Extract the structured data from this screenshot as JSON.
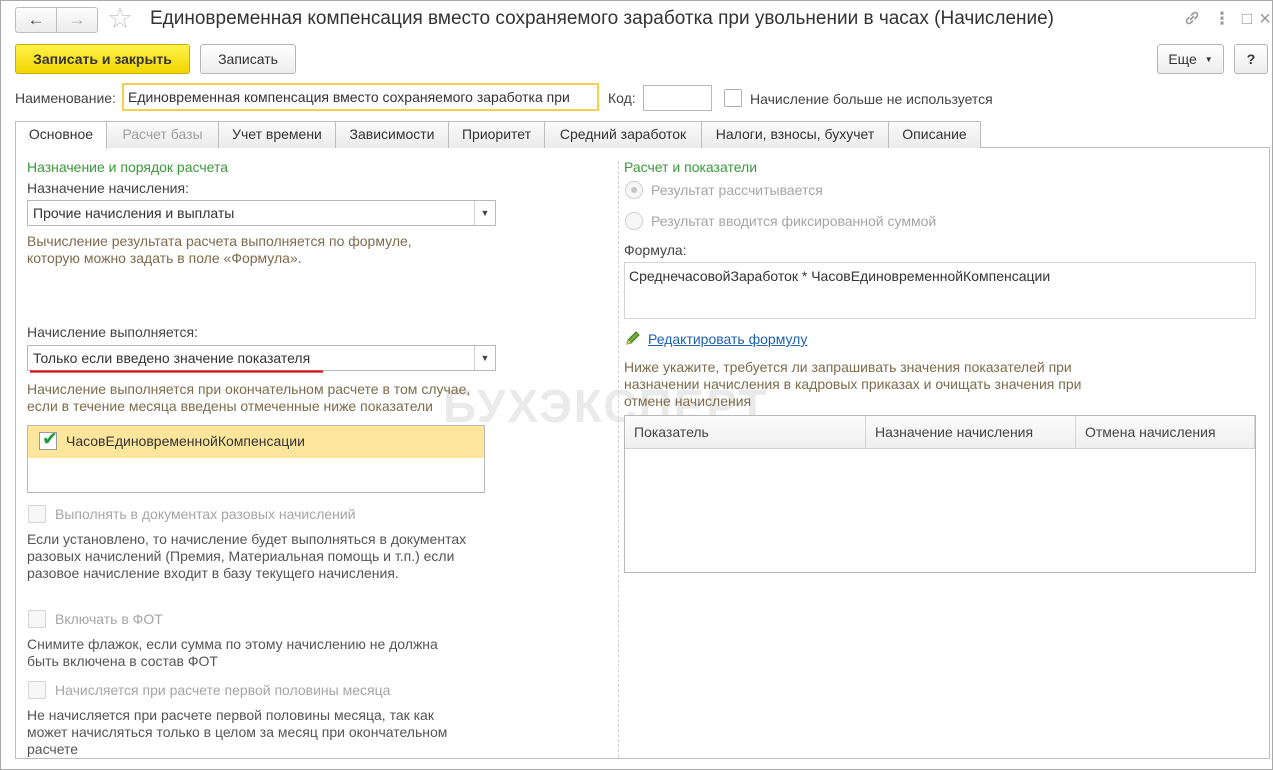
{
  "window": {
    "title": "Единовременная компенсация вместо сохраняемого заработка при увольнении в часах (Начисление)",
    "nav_back": "←",
    "nav_forward": "→",
    "favorite_icon": "☆",
    "link_icon": "🔗",
    "more_icon": "⋮",
    "maximize_icon": "□",
    "close_icon": "×"
  },
  "toolbar": {
    "save_close_label": "Записать и закрыть",
    "save_label": "Записать",
    "more_label": "Еще",
    "help_label": "?"
  },
  "header": {
    "name_label": "Наименование:",
    "name_value": "Единовременная компенсация вместо сохраняемого заработка при",
    "code_label": "Код:",
    "code_value": "",
    "not_used_label": "Начисление больше не используется"
  },
  "tabs": [
    {
      "label": "Основное"
    },
    {
      "label": "Расчет базы"
    },
    {
      "label": "Учет времени"
    },
    {
      "label": "Зависимости"
    },
    {
      "label": "Приоритет"
    },
    {
      "label": "Средний заработок"
    },
    {
      "label": "Налоги, взносы, бухучет"
    },
    {
      "label": "Описание"
    }
  ],
  "left": {
    "group_title": "Назначение и порядок расчета",
    "purpose_label": "Назначение начисления:",
    "purpose_value": "Прочие начисления и выплаты",
    "purpose_hint": "Вычисление результата расчета выполняется по формуле, которую можно задать в поле «Формула».",
    "performed_label": "Начисление выполняется:",
    "performed_value": "Только если введено значение показателя",
    "performed_hint": "Начисление выполняется при окончательном расчете в том случае, если в течение месяца введены отмеченные ниже показатели",
    "indicators": [
      {
        "name": "ЧасовЕдиновременнойКомпенсации",
        "checked": true
      }
    ],
    "one_time_label": "Выполнять в документах разовых начислений",
    "one_time_hint": "Если установлено, то начисление будет выполняться в документах разовых начислений (Премия, Материальная помощь и т.п.) если разовое начисление входит в базу текущего начисления.",
    "fot_label": "Включать в ФОТ",
    "fot_hint": "Снимите флажок, если сумма по этому начислению не должна быть включена в состав ФОТ",
    "half_month_label": "Начисляется при расчете первой половины месяца",
    "half_month_hint": "Не начисляется при расчете первой половины месяца, так как может начисляться только в целом за месяц при окончательном расчете"
  },
  "right": {
    "group_title": "Расчет и показатели",
    "radio_calculated": "Результат рассчитывается",
    "radio_fixed": "Результат вводится фиксированной суммой",
    "formula_label": "Формула:",
    "formula_value": "СреднечасовойЗаработок * ЧасовЕдиновременнойКомпенсации",
    "edit_formula_label": "Редактировать формулу",
    "indicators_hint": "Ниже укажите, требуется ли запрашивать значения показателей при назначении начисления в кадровых приказах и очищать значения при отмене начисления",
    "grid_columns": [
      "Показатель",
      "Назначение начисления",
      "Отмена начисления"
    ]
  },
  "watermark": "БУХЭКСПЕРТ",
  "colors": {
    "primary_button": "#f2d500",
    "group_title": "#3a9a3a",
    "hint_text": "#7d6b4c",
    "selected_row": "#fbe69b",
    "link": "#1f5fb2",
    "annotation_underline": "#d8141c"
  }
}
